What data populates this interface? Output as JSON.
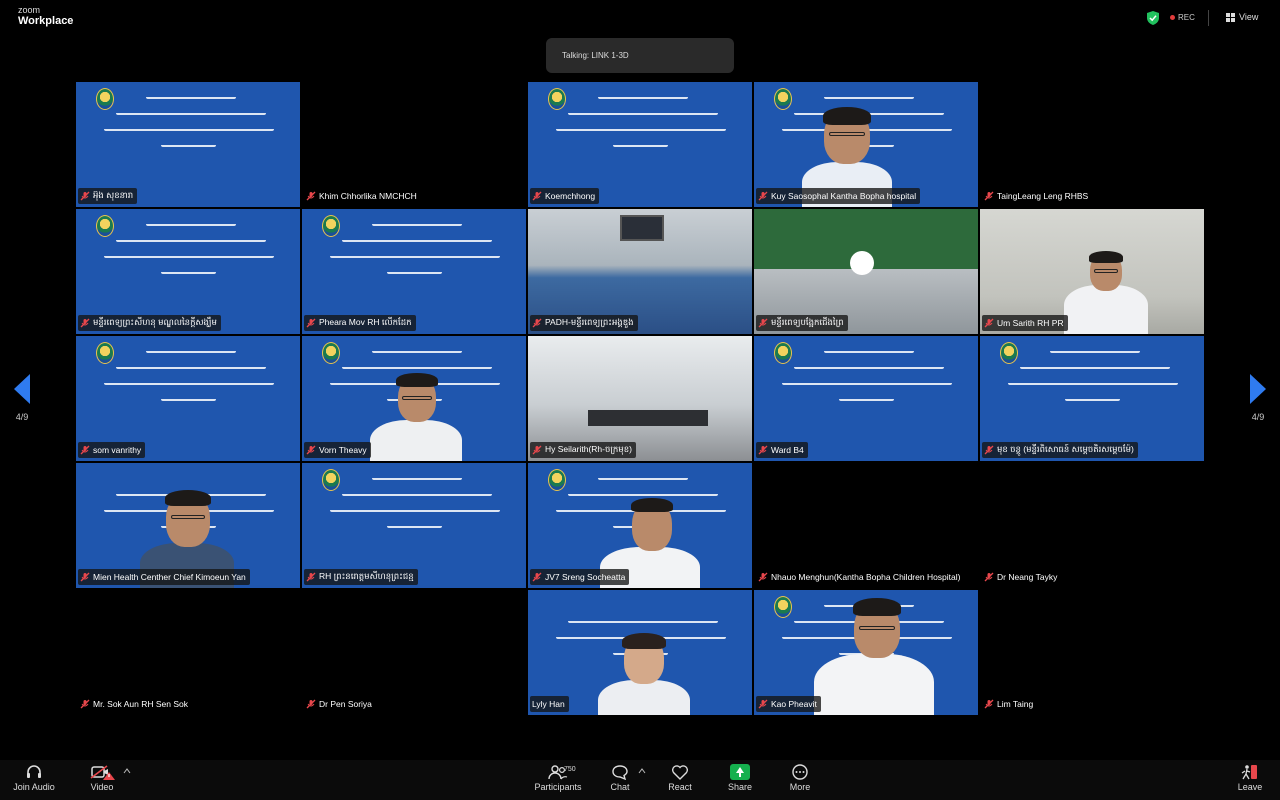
{
  "app": {
    "brand_line1": "zoom",
    "brand_line2": "Workplace"
  },
  "header": {
    "rec_label": "REC",
    "view_label": "View",
    "rec_color": "#e23c3c",
    "shield_color": "#21c15e"
  },
  "talking": {
    "text": "Talking: LINK 1-3D"
  },
  "pagination": {
    "left": "4/9",
    "right": "4/9"
  },
  "tiles": [
    {
      "name": "អ៊ុង សុខនារា",
      "kind": "blue"
    },
    {
      "name": "Khim Chhorlika NMCHCH",
      "kind": "black"
    },
    {
      "name": "Koemchhong",
      "kind": "blue"
    },
    {
      "name": "Kuy Saosophal Kantha Bopha hospital",
      "kind": "blue-person"
    },
    {
      "name": "TaingLeang Leng RHBS",
      "kind": "black"
    },
    {
      "name": "មន្ទីរពេទ្យព្រះសីហនុ មណ្ឌលនៃក្តីសង្ឃឹម",
      "kind": "blue"
    },
    {
      "name": "Pheara Mov RH លើកដែក",
      "kind": "blue"
    },
    {
      "name": "PADH-មន្ទីរពេទ្យព្រះអង្គឌួង",
      "kind": "room"
    },
    {
      "name": "មន្ទីរពេទ្យបង្អែកជើងព្រៃ",
      "kind": "flag"
    },
    {
      "name": "Um Sarith RH PR",
      "kind": "wall"
    },
    {
      "name": "som vanrithy",
      "kind": "blue"
    },
    {
      "name": "Vorn Theavy",
      "kind": "blue-person"
    },
    {
      "name": "Hy Seilarith(Rh-ចក្រមុខ)",
      "kind": "office"
    },
    {
      "name": "Ward B4",
      "kind": "blue"
    },
    {
      "name": "មុខ ចន្ថូ (មន្ទីរពិសោធន៍ សម្តេចតិរសម្តេចម៉ែ)",
      "kind": "blue"
    },
    {
      "name": "Mien Health Centher Chief Kimoeun Yan",
      "kind": "blue-person"
    },
    {
      "name": "RH ព្រះនរោត្តមសីហនុព្រះជន្ម",
      "kind": "blue"
    },
    {
      "name": "JV7 Sreng Socheatta",
      "kind": "blue-person"
    },
    {
      "name": "Nhauo Menghun(Kantha Bopha Children Hospital)",
      "kind": "black"
    },
    {
      "name": "Dr Neang Tayky",
      "kind": "black"
    },
    {
      "name": "Mr. Sok Aun RH Sen Sok",
      "kind": "black"
    },
    {
      "name": "Dr Pen Soriya",
      "kind": "black"
    },
    {
      "name": "Lyly Han",
      "kind": "blue-person"
    },
    {
      "name": "Kao Pheavit",
      "kind": "blue-person"
    },
    {
      "name": "Lim Taing",
      "kind": "black"
    }
  ],
  "toolbar": {
    "join_audio": "Join Audio",
    "video": "Video",
    "participants": "Participants",
    "participants_count": "750",
    "chat": "Chat",
    "react": "React",
    "share": "Share",
    "more": "More",
    "leave": "Leave",
    "share_color": "#15b04e"
  }
}
